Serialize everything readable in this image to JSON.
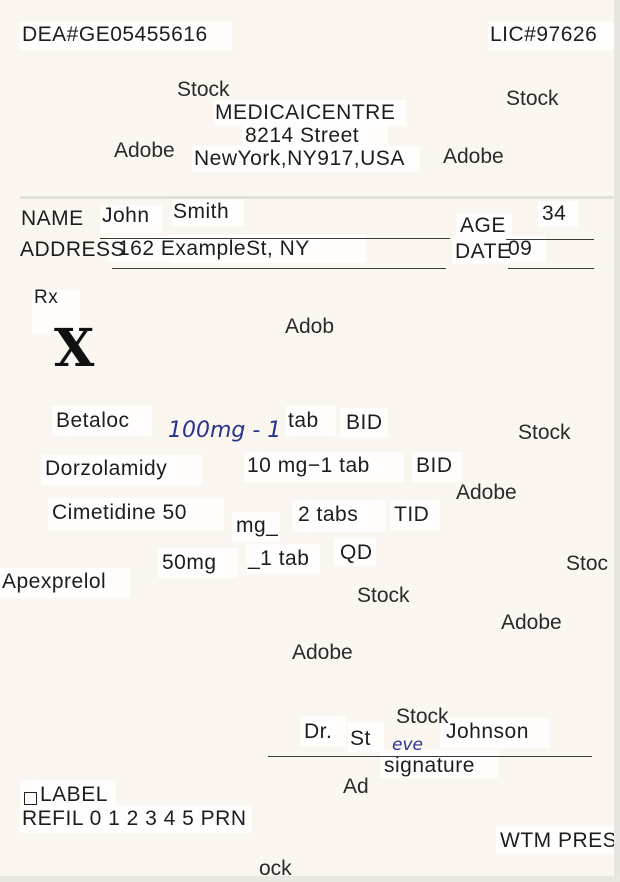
{
  "header": {
    "dea": "DEA#GE05455616",
    "lic": "LIC#97626",
    "clinic_name": "MEDICAICENTRE",
    "street": "8214 Street",
    "city": "NewYork,NY917,USA"
  },
  "patient": {
    "name_label": "NAME",
    "first_name": "John",
    "last_name": "Smith",
    "age_label": "AGE",
    "age_value": "34",
    "address_label": "ADDRESS",
    "address_value": "162 ExampleSt, NY",
    "date_label": "DATE",
    "date_value": "09"
  },
  "rx": {
    "rx_label": "Rx",
    "mark": "X",
    "items": [
      {
        "drug": "Betaloc",
        "dose": "100mg - 1",
        "qty": "tab",
        "freq": "BID"
      },
      {
        "drug": "Dorzolamidy",
        "dose": "10 mg−1 tab",
        "freq": "BID"
      },
      {
        "drug": "Cimetidine 50",
        "dose": "mg_",
        "qty": "2  tabs",
        "freq": "TID"
      },
      {
        "drug": "Apexprelol",
        "dose": "50mg",
        "qty": "_1 tab",
        "freq": "QD"
      }
    ]
  },
  "signature": {
    "doctor_prefix": "Dr.",
    "doctor_first": "St",
    "doctor_script": "eve",
    "doctor_last": "Johnson",
    "label": "signature"
  },
  "footer": {
    "label_text": "LABEL",
    "refill_text": "REFIL 0 1 2  3 4 5 PRN",
    "corner_text": "WTM PRESC"
  },
  "watermarks": {
    "stock": "Stock",
    "adobe": "Adobe",
    "adob": "Adob",
    "ad": "Ad",
    "stoc": "Stoc",
    "ock": "ock"
  }
}
